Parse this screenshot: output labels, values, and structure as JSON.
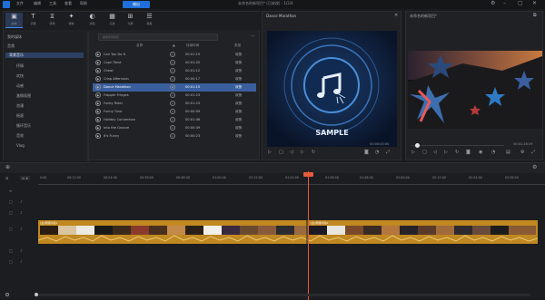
{
  "titlebar": {
    "menus": [
      "文件",
      "编辑",
      "工具",
      "查看",
      "帮助"
    ],
    "export_label": "输出",
    "project_title": "未命名的新项目* (已修改) - 1/2/4"
  },
  "toolbar": {
    "tabs": [
      {
        "label": "媒体",
        "icon": "▣"
      },
      {
        "label": "字幕",
        "icon": "T"
      },
      {
        "label": "转场",
        "icon": "⧖"
      },
      {
        "label": "特效",
        "icon": "✦"
      },
      {
        "label": "滤镜",
        "icon": "◐"
      },
      {
        "label": "元素",
        "icon": "▦"
      },
      {
        "label": "分屏",
        "icon": "⊞"
      },
      {
        "label": "模板",
        "icon": "☰"
      }
    ]
  },
  "categories": [
    {
      "label": "我的媒体",
      "selected": false
    },
    {
      "label": "音频",
      "selected": false
    },
    {
      "label": "背景音乐",
      "selected": true
    },
    {
      "label": "抒情",
      "selected": false
    },
    {
      "label": "欢快",
      "selected": false
    },
    {
      "label": "动感",
      "selected": false
    },
    {
      "label": "激情氛围",
      "selected": false
    },
    {
      "label": "浪漫",
      "selected": false
    },
    {
      "label": "摇滚",
      "selected": false
    },
    {
      "label": "循环音乐",
      "selected": false
    },
    {
      "label": "音效",
      "selected": false
    },
    {
      "label": "Vlog",
      "selected": false
    }
  ],
  "music": {
    "search_placeholder": "搜索背景音乐",
    "more_label": "···",
    "headers": {
      "name": "名称",
      "duration": "持续时间",
      "tag": "类型"
    },
    "tracks": [
      {
        "name": "Can You Do It",
        "duration": "00:01:19",
        "tag": "欢快",
        "selected": false
      },
      {
        "name": "Capri Twist",
        "duration": "00:01:20",
        "tag": "欢快",
        "selected": false
      },
      {
        "name": "Cheat",
        "duration": "00:01:12",
        "tag": "欢快",
        "selected": false
      },
      {
        "name": "Crisp Afternoon",
        "duration": "00:00:17",
        "tag": "欢快",
        "selected": false
      },
      {
        "name": "Dance Marathon",
        "duration": "00:01:15",
        "tag": "欢快",
        "selected": true
      },
      {
        "name": "Flapper Fringes",
        "duration": "00:01:23",
        "tag": "欢快",
        "selected": false
      },
      {
        "name": "Funky Rider",
        "duration": "00:01:23",
        "tag": "欢快",
        "selected": false
      },
      {
        "name": "Funny Tune",
        "duration": "00:00:09",
        "tag": "欢快",
        "selected": false
      },
      {
        "name": "Holiday Connection",
        "duration": "00:01:46",
        "tag": "欢快",
        "selected": false
      },
      {
        "name": "Into the Groove",
        "duration": "00:00:49",
        "tag": "欢快",
        "selected": false
      },
      {
        "name": "It's Funny",
        "duration": "00:00:23",
        "tag": "欢快",
        "selected": false
      }
    ]
  },
  "preview": {
    "title": "Dance Marathon",
    "sample_text": "SAMPLE",
    "time": "00:00:00:00"
  },
  "mainview": {
    "title": "未命名的新项目*",
    "time": "00:01:28:19"
  },
  "timeline": {
    "ruler_labels": [
      "0:00",
      "00:12:00",
      "00:24:00",
      "00:36:00",
      "00:48:00",
      "01:00:00",
      "01:12:00",
      "01:24:00",
      "01:36:00",
      "01:48:00",
      "02:00:00",
      "02:12:00",
      "02:24:00",
      "02:36:00"
    ],
    "clip1_label": "[主]视频片段1",
    "clip2_label": "[主]视频片段2",
    "track_icons": [
      "≡",
      "▢",
      "♪",
      "▢",
      "♪",
      "▢",
      "♪",
      "▢",
      "♪"
    ]
  },
  "colors": {
    "accent": "#1e6fd9",
    "playhead": "#e85a3c",
    "clip": "#c08820"
  }
}
